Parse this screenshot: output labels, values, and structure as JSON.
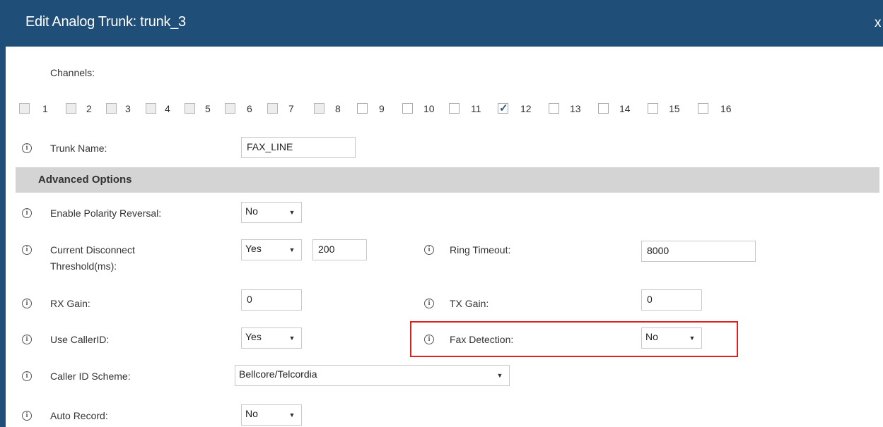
{
  "dialog": {
    "title": "Edit Analog Trunk: trunk_3",
    "close": "x"
  },
  "channels": {
    "label": "Channels:",
    "items": [
      {
        "num": "1",
        "checked": false,
        "enabled": false
      },
      {
        "num": "2",
        "checked": false,
        "enabled": false
      },
      {
        "num": "3",
        "checked": false,
        "enabled": false
      },
      {
        "num": "4",
        "checked": false,
        "enabled": false
      },
      {
        "num": "5",
        "checked": false,
        "enabled": false
      },
      {
        "num": "6",
        "checked": false,
        "enabled": false
      },
      {
        "num": "7",
        "checked": false,
        "enabled": false
      },
      {
        "num": "8",
        "checked": false,
        "enabled": false
      },
      {
        "num": "9",
        "checked": false,
        "enabled": true
      },
      {
        "num": "10",
        "checked": false,
        "enabled": true
      },
      {
        "num": "11",
        "checked": false,
        "enabled": true
      },
      {
        "num": "12",
        "checked": true,
        "enabled": true
      },
      {
        "num": "13",
        "checked": false,
        "enabled": true
      },
      {
        "num": "14",
        "checked": false,
        "enabled": true
      },
      {
        "num": "15",
        "checked": false,
        "enabled": true
      },
      {
        "num": "16",
        "checked": false,
        "enabled": true
      }
    ]
  },
  "trunk_name": {
    "label": "Trunk Name:",
    "value": "FAX_LINE"
  },
  "advanced": {
    "title": "Advanced Options",
    "polarity": {
      "label": "Enable Polarity Reversal:",
      "value": "No"
    },
    "disconnect": {
      "label_line1": "Current Disconnect",
      "label_line2": "Threshold(ms):",
      "select": "Yes",
      "value": "200"
    },
    "ring_timeout": {
      "label": "Ring Timeout:",
      "value": "8000"
    },
    "rx_gain": {
      "label": "RX Gain:",
      "value": "0"
    },
    "tx_gain": {
      "label": "TX Gain:",
      "value": "0"
    },
    "callerid": {
      "label": "Use CallerID:",
      "value": "Yes"
    },
    "fax_detection": {
      "label": "Fax Detection:",
      "value": "No"
    },
    "callerid_scheme": {
      "label": "Caller ID Scheme:",
      "value": "Bellcore/Telcordia"
    },
    "auto_record": {
      "label": "Auto Record:",
      "value": "No"
    }
  },
  "icons": {
    "info": "info-icon",
    "dropdown": "dropdown-arrow-icon",
    "check": "check-icon"
  },
  "colors": {
    "titlebar": "#1f4e79",
    "section_bar": "#d4d4d4",
    "highlight": "#e01f1f"
  }
}
